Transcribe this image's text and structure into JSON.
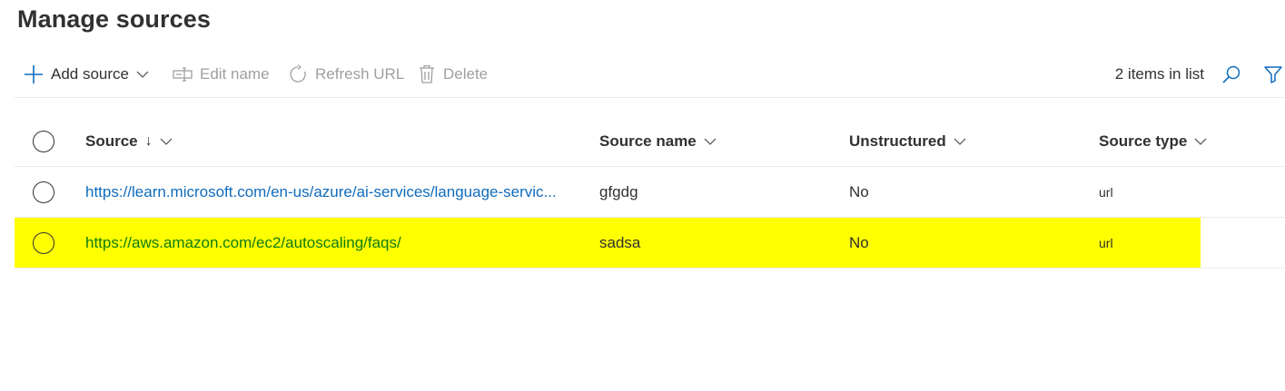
{
  "page": {
    "title": "Manage sources"
  },
  "toolbar": {
    "add_source": "Add source",
    "edit_name": "Edit name",
    "refresh_url": "Refresh URL",
    "delete": "Delete",
    "item_count": "2 items in list",
    "icons": [
      "plus-icon",
      "chevron-down-icon",
      "rename-icon",
      "refresh-icon",
      "trash-icon",
      "search-icon",
      "filter-icon"
    ]
  },
  "table": {
    "columns": {
      "source": "Source",
      "source_sort": "↓",
      "source_name": "Source name",
      "unstructured": "Unstructured",
      "source_type": "Source type"
    },
    "rows": [
      {
        "source": "https://learn.microsoft.com/en-us/azure/ai-services/language-servic...",
        "source_name": "gfgdg",
        "unstructured": "No",
        "source_type": "url",
        "highlighted": false
      },
      {
        "source": "https://aws.amazon.com/ec2/autoscaling/faqs/",
        "source_name": "sadsa",
        "unstructured": "No",
        "source_type": "url",
        "highlighted": true
      }
    ]
  },
  "colors": {
    "accent": "#0f6cbd",
    "highlight": "#ffff00",
    "highlight_link": "#107c10",
    "disabled": "#a19f9d"
  }
}
